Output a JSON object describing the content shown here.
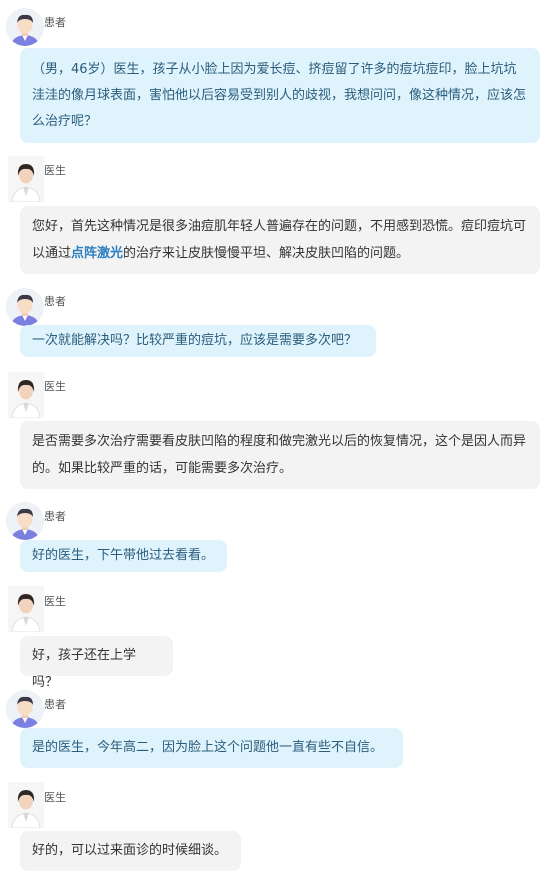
{
  "messages": [
    {
      "role": "patient",
      "name": "患者",
      "avatar_icon": "patient-avatar-icon",
      "text": "（男，46岁）医生，孩子从小脸上因为爱长痘、挤痘留了许多的痘坑痘印，脸上坑坑洼洼的像月球表面，害怕他以后容易受到别人的歧视，我想问问，像这种情况，应该怎么治疗呢？"
    },
    {
      "role": "doctor",
      "name": "医生",
      "avatar_icon": "doctor-avatar-icon",
      "text_before": "您好，首先这种情况是很多油痘肌年轻人普遍存在的问题，不用感到恐慌。痘印痘坑可以通过",
      "highlight": "点阵激光",
      "text_after": "的治疗来让皮肤慢慢平坦、解决皮肤凹陷的问题。"
    },
    {
      "role": "patient",
      "name": "患者",
      "avatar_icon": "patient-avatar-icon",
      "text": "一次就能解决吗？比较严重的痘坑，应该是需要多次吧？"
    },
    {
      "role": "doctor",
      "name": "医生",
      "avatar_icon": "doctor-avatar-icon",
      "text": "是否需要多次治疗需要看皮肤凹陷的程度和做完激光以后的恢复情况，这个是因人而异的。如果比较严重的话，可能需要多次治疗。"
    },
    {
      "role": "patient",
      "name": "患者",
      "avatar_icon": "patient-avatar-icon",
      "text": "好的医生，下午带他过去看看。"
    },
    {
      "role": "doctor",
      "name": "医生",
      "avatar_icon": "doctor-avatar-icon",
      "text": "好，孩子还在上学吗？"
    },
    {
      "role": "patient",
      "name": "患者",
      "avatar_icon": "patient-avatar-icon",
      "text": "是的医生，今年高二，因为脸上这个问题他一直有些不自信。"
    },
    {
      "role": "doctor",
      "name": "医生",
      "avatar_icon": "doctor-avatar-icon",
      "text": "好的，可以过来面诊的时候细谈。"
    }
  ]
}
